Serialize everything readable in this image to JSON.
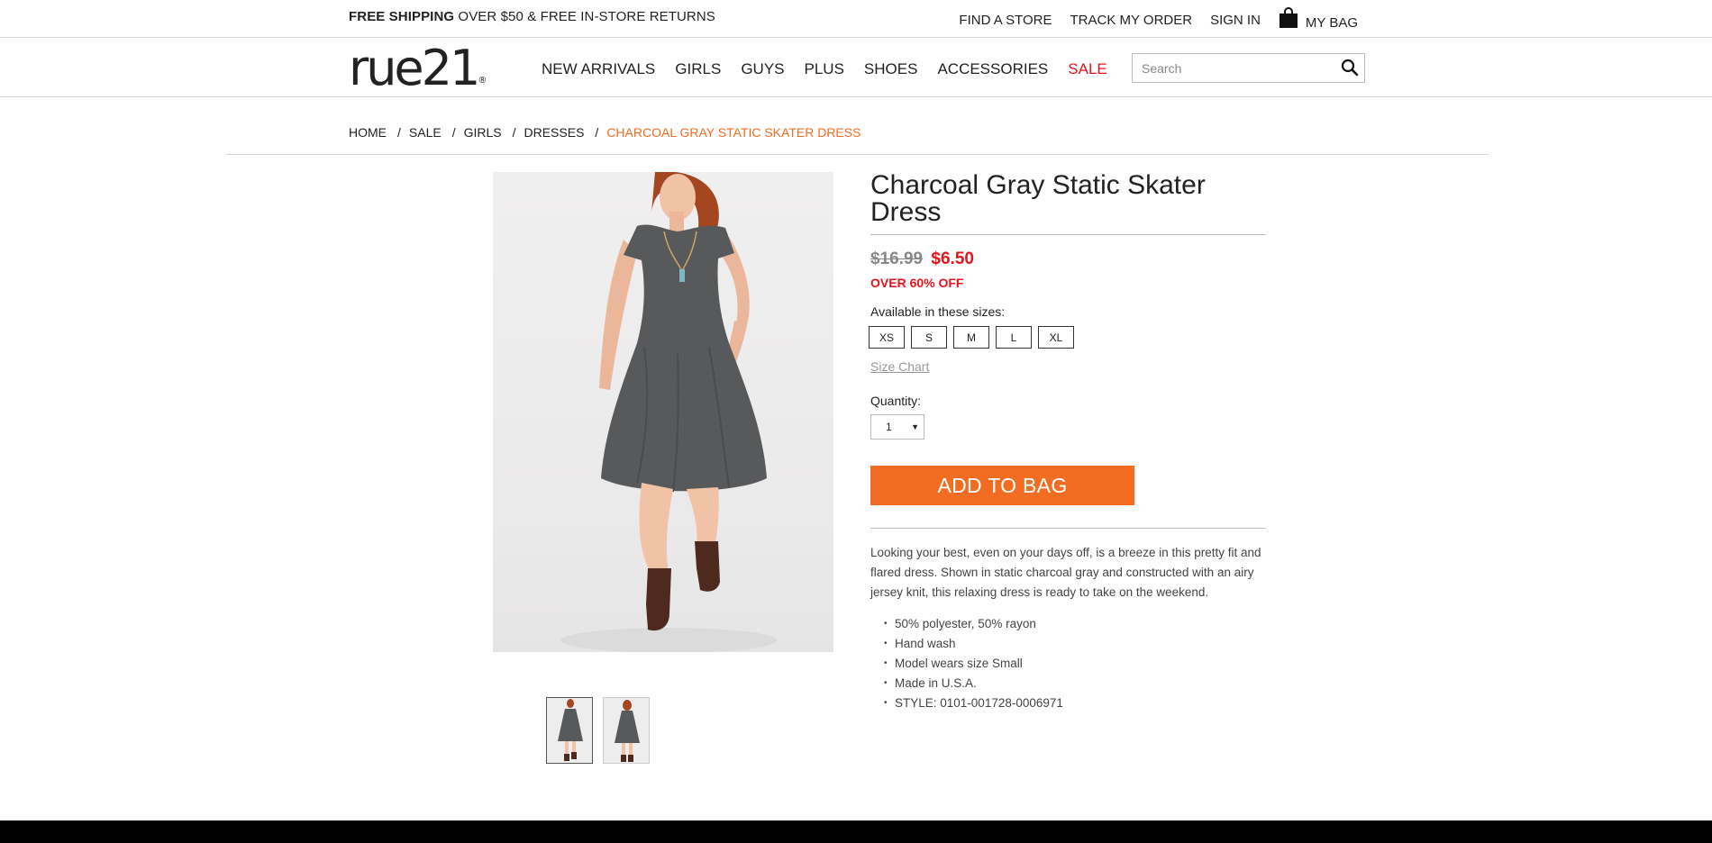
{
  "promo": {
    "bold": "FREE SHIPPING",
    "rest": " OVER $50 & FREE IN-STORE RETURNS"
  },
  "utility": {
    "find_store": "FIND A STORE",
    "track_order": "TRACK MY ORDER",
    "sign_in": "SIGN IN",
    "bag": "MY BAG"
  },
  "logo": "rue21",
  "nav": [
    "NEW ARRIVALS",
    "GIRLS",
    "GUYS",
    "PLUS",
    "SHOES",
    "ACCESSORIES",
    "SALE"
  ],
  "search": {
    "placeholder": "Search"
  },
  "breadcrumb": {
    "home": "HOME",
    "sale": "SALE",
    "girls": "GIRLS",
    "dresses": "DRESSES",
    "current": "CHARCOAL GRAY STATIC SKATER DRESS"
  },
  "product": {
    "title": "Charcoal Gray Static Skater Dress",
    "price_was": "$16.99",
    "price_now": "$6.50",
    "discount": "OVER 60% OFF",
    "sizes_label": "Available in these sizes:",
    "sizes": [
      "XS",
      "S",
      "M",
      "L",
      "XL"
    ],
    "size_chart": "Size Chart",
    "quantity_label": "Quantity:",
    "quantity": "1",
    "add_to_bag": "ADD TO BAG",
    "description": "Looking your best, even on your days off, is a breeze in this pretty fit and flared dress. Shown in static charcoal gray and constructed with an airy jersey knit, this relaxing dress is ready to take on the weekend.",
    "details": [
      "50% polyester, 50% rayon",
      "Hand wash",
      "Model wears size Small",
      "Made in U.S.A.",
      "STYLE: 0101-001728-0006971"
    ]
  },
  "colors": {
    "accent": "#f26c22",
    "sale": "#e8141b"
  }
}
